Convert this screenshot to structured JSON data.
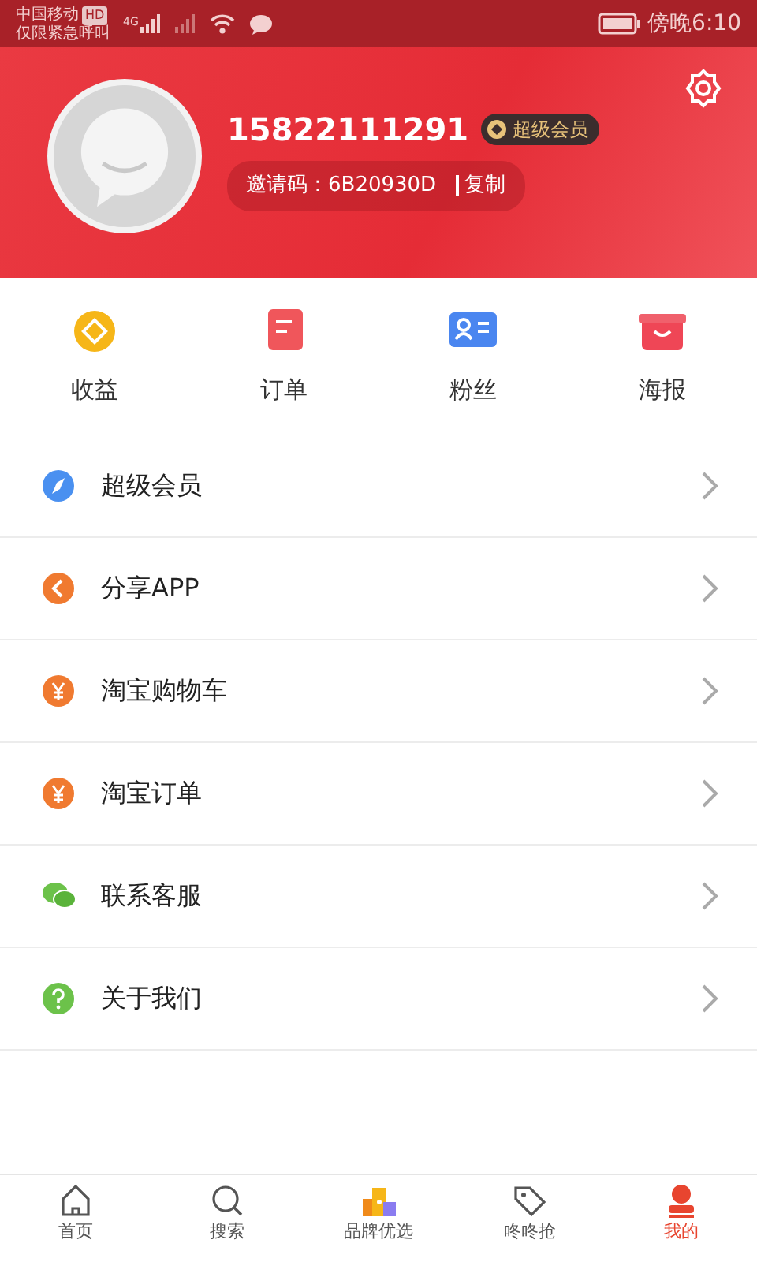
{
  "status_bar": {
    "carrier": "中国移动",
    "carrier_badge": "HD",
    "emergency": "仅限紧急呼叫",
    "network": "4G",
    "time": "傍晚6:10"
  },
  "profile": {
    "phone": "15822111291",
    "member_badge": "超级会员",
    "invite_label": "邀请码：6B20930D",
    "copy": "复制"
  },
  "shortcuts": [
    {
      "label": "收益"
    },
    {
      "label": "订单"
    },
    {
      "label": "粉丝"
    },
    {
      "label": "海报"
    }
  ],
  "menu": [
    {
      "label": "超级会员"
    },
    {
      "label": "分享APP"
    },
    {
      "label": "淘宝购物车"
    },
    {
      "label": "淘宝订单"
    },
    {
      "label": "联系客服"
    },
    {
      "label": "关于我们"
    }
  ],
  "tab_bar": [
    {
      "label": "首页",
      "selected": false
    },
    {
      "label": "搜索",
      "selected": false
    },
    {
      "label": "品牌优选",
      "selected": false
    },
    {
      "label": "咚咚抢",
      "selected": false
    },
    {
      "label": "我的",
      "selected": true
    }
  ]
}
